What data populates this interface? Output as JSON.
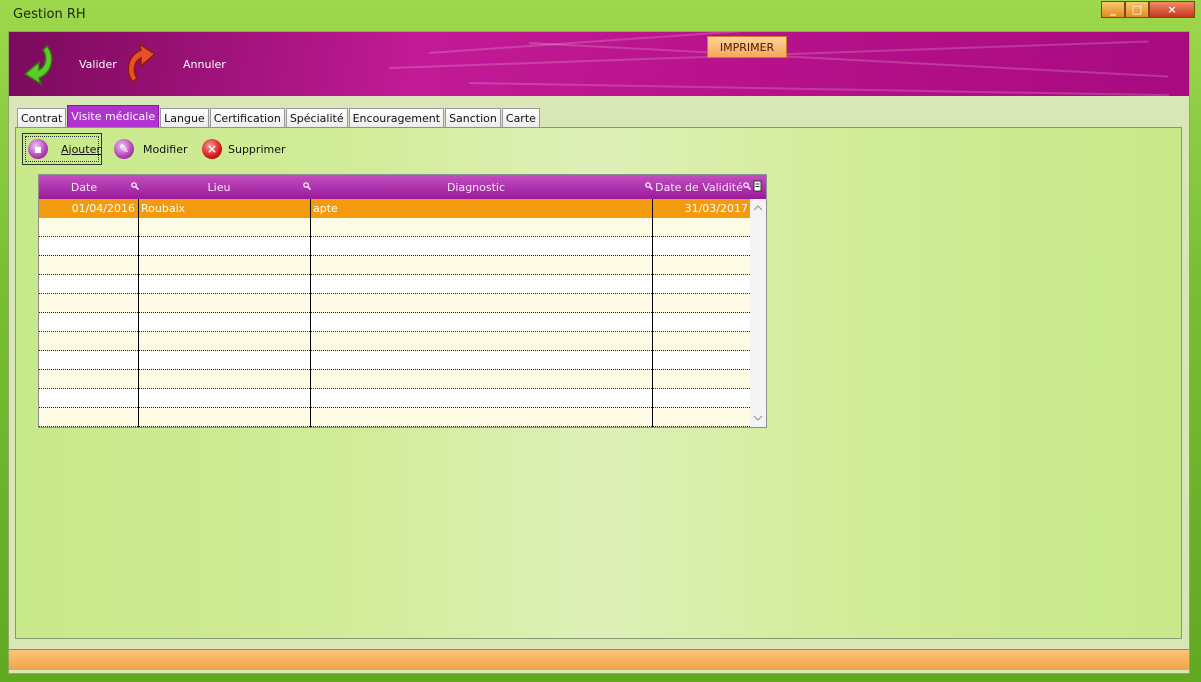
{
  "window": {
    "title": "Gestion RH"
  },
  "toolbar": {
    "validate_label": "Valider",
    "cancel_label": "Annuler",
    "print_label": "IMPRIMER"
  },
  "tabs": [
    {
      "label": "Contrat",
      "active": false
    },
    {
      "label": "Visite médicale",
      "active": true
    },
    {
      "label": "Langue",
      "active": false
    },
    {
      "label": "Certification",
      "active": false
    },
    {
      "label": "Spécialité",
      "active": false
    },
    {
      "label": "Encouragement",
      "active": false
    },
    {
      "label": "Sanction",
      "active": false
    },
    {
      "label": "Carte",
      "active": false
    }
  ],
  "actions": {
    "add_label": "Ajouter",
    "edit_label": "Modifier",
    "delete_label": "Supprimer"
  },
  "grid": {
    "columns": [
      "Date",
      "Lieu",
      "Diagnostic",
      "Date de Validité"
    ],
    "rows": [
      {
        "date": "01/04/2016",
        "lieu": "Roubaix",
        "diagnostic": "apte",
        "validite": "31/03/2017",
        "selected": true
      }
    ],
    "visible_row_count": 12
  },
  "colors": {
    "banner": "#b8128c",
    "active_tab": "#b033d0",
    "selected_row": "#f39a0e",
    "print_button": "#f6a75a"
  },
  "icons": {
    "validate": "green-curved-arrow-icon",
    "cancel": "red-curved-arrow-icon",
    "add": "add-record-icon",
    "edit": "edit-record-icon",
    "delete": "delete-x-icon"
  }
}
